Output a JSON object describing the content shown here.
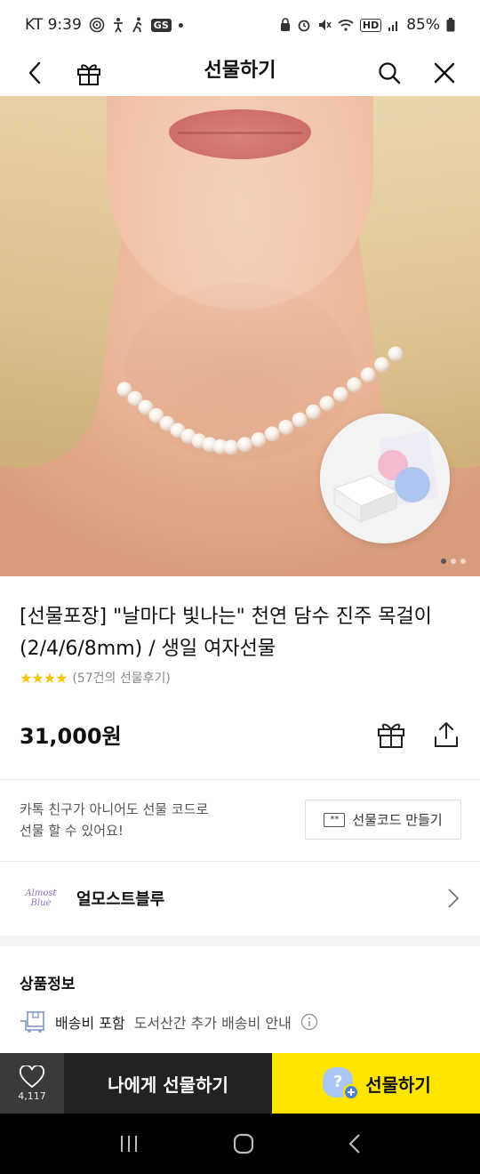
{
  "status_bar": {
    "carrier_time": "KT 9:39",
    "badge": "GS",
    "hd_label": "HD",
    "battery": "85%"
  },
  "nav": {
    "title": "선물하기"
  },
  "product": {
    "title": "[선물포장] \"날마다 빛나는\" 천연 담수 진주 목걸이(2/4/6/8mm) / 생일 여자선물",
    "stars": "★★★★",
    "review_count": "(57건의 선물후기)",
    "price": "31,000원",
    "image_pages": 3,
    "image_active_page": 1
  },
  "gift_code": {
    "description_line1": "카톡 친구가 아니어도 선물 코드로",
    "description_line2": "선물 할 수 있어요!",
    "button_label": "선물코드 만들기",
    "button_icon_text": "**"
  },
  "brand": {
    "logo_text_line1": "Almost",
    "logo_text_line2": "Blue",
    "name": "얼모스트블루"
  },
  "product_info": {
    "section_title": "상품정보",
    "shipping_label": "배송비 포함",
    "shipping_sub": "도서산간 추가 배송비 안내"
  },
  "bottom_bar": {
    "like_count": "4,117",
    "self_gift_label": "나에게 선물하기",
    "gift_label": "선물하기",
    "avatar_mark": "?"
  },
  "colors": {
    "kakao_yellow": "#fee500",
    "dark_button": "#222222",
    "star_yellow": "#f5c400"
  }
}
